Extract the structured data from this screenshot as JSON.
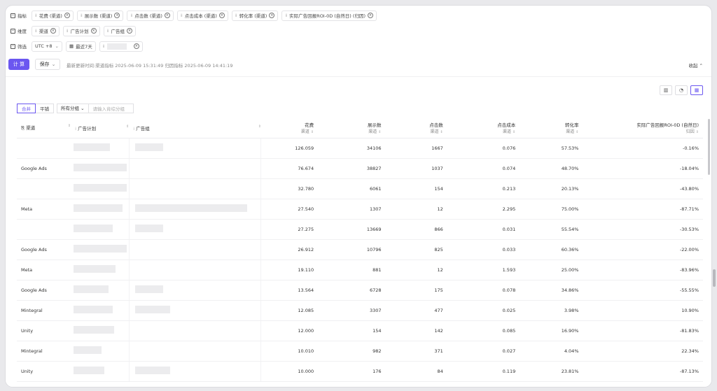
{
  "filters": {
    "metrics_label": "指标",
    "metrics": [
      "花费 (渠道)",
      "展示数 (渠道)",
      "点击数 (渠道)",
      "点击成本 (渠道)",
      "转化率 (渠道)",
      "实际广告回报ROI-0D (自然日) (归因)"
    ],
    "dims_label": "维度",
    "dims": [
      "渠道",
      "广告计划",
      "广告组"
    ],
    "filter_label": "筛选",
    "timezone": "UTC +8",
    "date_range": "最近7天"
  },
  "actions": {
    "calc": "计 算",
    "save": "保存",
    "update_text": "最新更新时间:渠道指标 2025-06-09 15:31:49 归因指标 2025-06-09 14:41:19",
    "collapse": "收起"
  },
  "table_controls": {
    "merge": "合并",
    "flat": "平铺",
    "all_groups": "所有分组",
    "group_placeholder": "请输入肯综分组"
  },
  "columns": {
    "channel": "渠道",
    "plan": "广告计划",
    "group": "广告组",
    "spend": "花费",
    "impressions": "展示数",
    "clicks": "点击数",
    "cpc": "点击成本",
    "cvr": "转化率",
    "roi": "实际广告回报ROI-0D (自然日)",
    "source_channel": "渠道",
    "source_attr": "归因"
  },
  "rows": [
    {
      "channel": "",
      "spend": "126.059",
      "impressions": "34106",
      "clicks": "1667",
      "cpc": "0.076",
      "cvr": "57.53%",
      "roi": "-0.16%"
    },
    {
      "channel": "Google Ads",
      "spend": "76.674",
      "impressions": "38827",
      "clicks": "1037",
      "cpc": "0.074",
      "cvr": "48.70%",
      "roi": "-18.04%"
    },
    {
      "channel": "",
      "spend": "32.780",
      "impressions": "6061",
      "clicks": "154",
      "cpc": "0.213",
      "cvr": "20.13%",
      "roi": "-43.80%"
    },
    {
      "channel": "Meta",
      "spend": "27.540",
      "impressions": "1307",
      "clicks": "12",
      "cpc": "2.295",
      "cvr": "75.00%",
      "roi": "-87.71%"
    },
    {
      "channel": "",
      "spend": "27.275",
      "impressions": "13669",
      "clicks": "866",
      "cpc": "0.031",
      "cvr": "55.54%",
      "roi": "-30.53%"
    },
    {
      "channel": "Google Ads",
      "spend": "26.912",
      "impressions": "10796",
      "clicks": "825",
      "cpc": "0.033",
      "cvr": "60.36%",
      "roi": "-22.00%"
    },
    {
      "channel": "Meta",
      "spend": "19.110",
      "impressions": "881",
      "clicks": "12",
      "cpc": "1.593",
      "cvr": "25.00%",
      "roi": "-83.96%"
    },
    {
      "channel": "Google Ads",
      "spend": "13.564",
      "impressions": "6728",
      "clicks": "175",
      "cpc": "0.078",
      "cvr": "34.86%",
      "roi": "-55.55%"
    },
    {
      "channel": "Mintegral",
      "spend": "12.085",
      "impressions": "3307",
      "clicks": "477",
      "cpc": "0.025",
      "cvr": "3.98%",
      "roi": "10.90%"
    },
    {
      "channel": "Unity",
      "spend": "12.000",
      "impressions": "154",
      "clicks": "142",
      "cpc": "0.085",
      "cvr": "16.90%",
      "roi": "-81.83%"
    },
    {
      "channel": "Mintegral",
      "spend": "10.010",
      "impressions": "982",
      "clicks": "371",
      "cpc": "0.027",
      "cvr": "4.04%",
      "roi": "22.34%"
    },
    {
      "channel": "Unity",
      "spend": "10.000",
      "impressions": "176",
      "clicks": "84",
      "cpc": "0.119",
      "cvr": "23.81%",
      "roi": "-87.13%"
    }
  ]
}
